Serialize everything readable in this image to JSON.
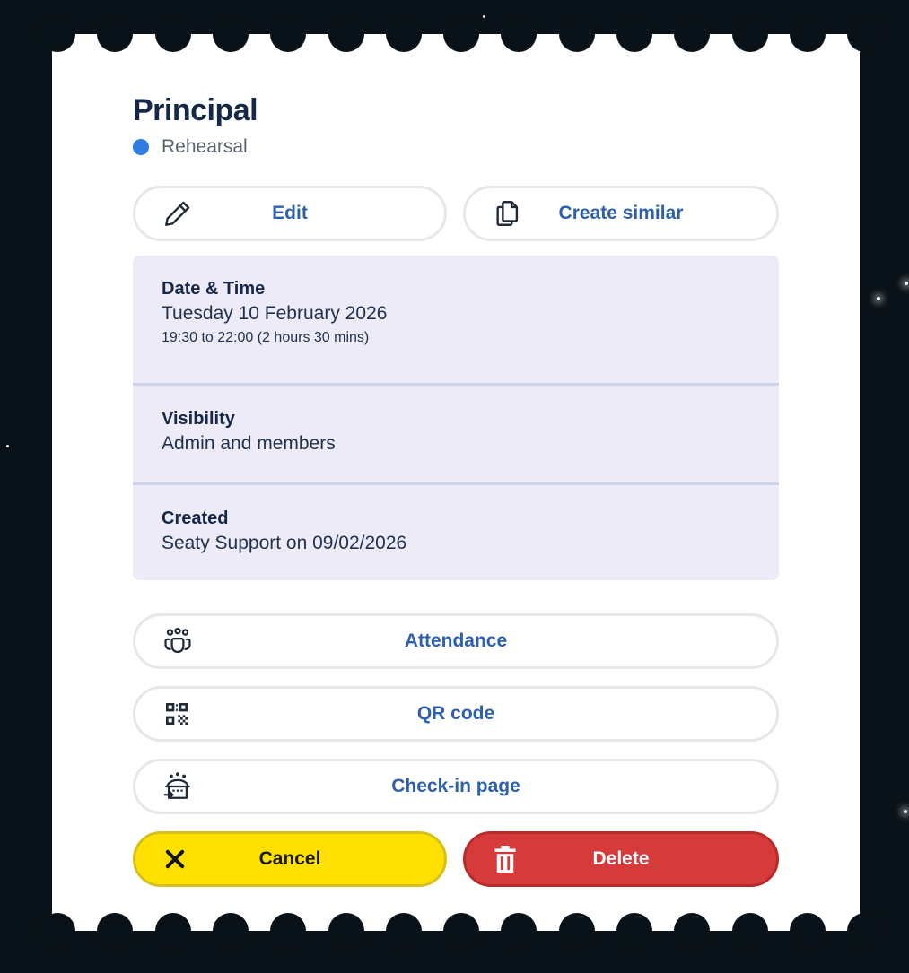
{
  "event": {
    "title": "Principal",
    "status": "Rehearsal",
    "status_color": "#2f7de1"
  },
  "actions": {
    "edit": {
      "label": "Edit",
      "icon": "pencil-icon"
    },
    "create_similar": {
      "label": "Create similar",
      "icon": "copy-icon"
    }
  },
  "details": {
    "datetime": {
      "heading": "Date & Time",
      "date": "Tuesday 10 February 2026",
      "time": "19:30 to 22:00 (2 hours 30 mins)"
    },
    "visibility": {
      "heading": "Visibility",
      "value": "Admin and members"
    },
    "created": {
      "heading": "Created",
      "value": "Seaty Support on 09/02/2026"
    }
  },
  "links": {
    "attendance": {
      "label": "Attendance",
      "icon": "group-icon"
    },
    "qr": {
      "label": "QR code",
      "icon": "qr-code-icon"
    },
    "checkin": {
      "label": "Check-in page",
      "icon": "check-in-icon"
    }
  },
  "footer": {
    "cancel": {
      "label": "Cancel",
      "icon": "close-icon",
      "color": "#ffe000"
    },
    "delete": {
      "label": "Delete",
      "icon": "trash-icon",
      "color": "#d63a3a"
    }
  }
}
